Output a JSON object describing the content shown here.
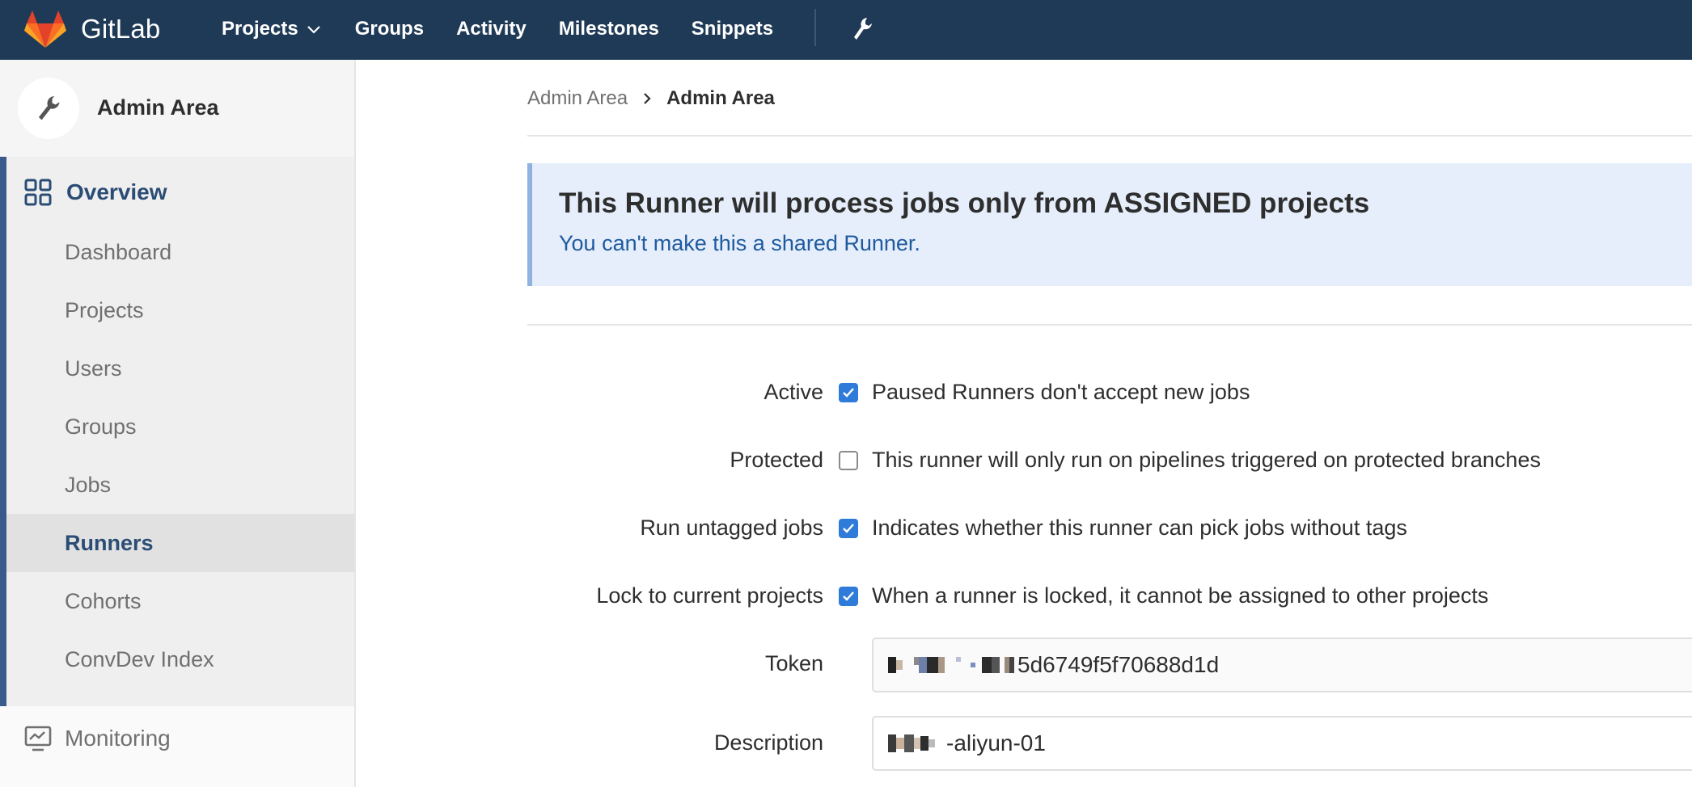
{
  "navbar": {
    "brand": "GitLab",
    "links": [
      "Projects",
      "Groups",
      "Activity",
      "Milestones",
      "Snippets"
    ]
  },
  "sidebar": {
    "title": "Admin Area",
    "overview_label": "Overview",
    "items": [
      {
        "label": "Dashboard",
        "active": false
      },
      {
        "label": "Projects",
        "active": false
      },
      {
        "label": "Users",
        "active": false
      },
      {
        "label": "Groups",
        "active": false
      },
      {
        "label": "Jobs",
        "active": false
      },
      {
        "label": "Runners",
        "active": true
      },
      {
        "label": "Cohorts",
        "active": false
      },
      {
        "label": "ConvDev Index",
        "active": false
      }
    ],
    "monitoring_label": "Monitoring"
  },
  "breadcrumb": {
    "parent": "Admin Area",
    "current": "Admin Area"
  },
  "alert": {
    "title": "This Runner will process jobs only from ASSIGNED projects",
    "subtitle": "You can't make this a shared Runner."
  },
  "form": {
    "active": {
      "label": "Active",
      "checked": true,
      "hint": "Paused Runners don't accept new jobs"
    },
    "protected": {
      "label": "Protected",
      "checked": false,
      "hint": "This runner will only run on pipelines triggered on protected branches"
    },
    "run_untagged": {
      "label": "Run untagged jobs",
      "checked": true,
      "hint": "Indicates whether this runner can pick jobs without tags"
    },
    "locked": {
      "label": "Lock to current projects",
      "checked": true,
      "hint": "When a runner is locked, it cannot be assigned to other projects"
    },
    "token": {
      "label": "Token",
      "visible_value": "5d6749f5f70688d1d"
    },
    "description": {
      "label": "Description",
      "visible_value": "-aliyun-01"
    }
  },
  "colors": {
    "navbar_bg": "#1f3a57",
    "accent_blue": "#2b4c74",
    "checkbox_blue": "#2f7bd9",
    "alert_bg": "#e5eefa",
    "alert_link": "#1f5aa0"
  }
}
